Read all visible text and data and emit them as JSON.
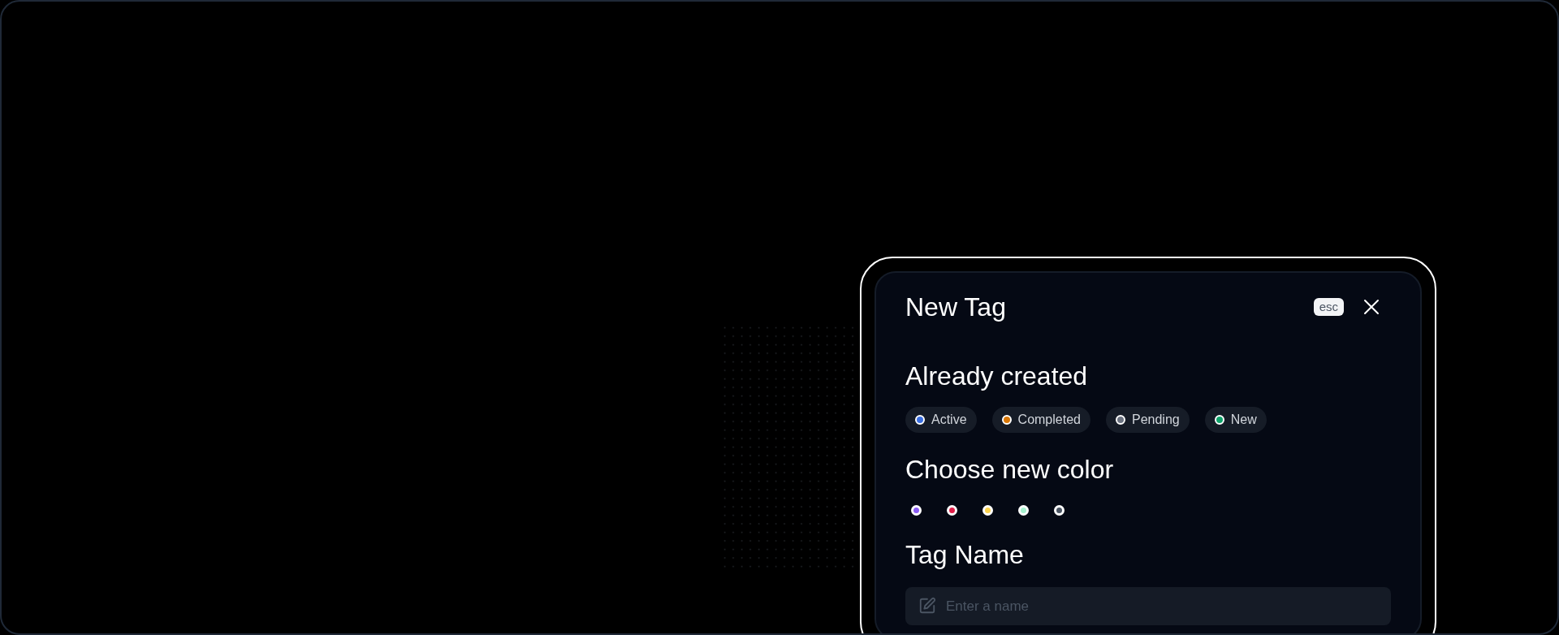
{
  "dialog": {
    "title": "New Tag",
    "esc_badge": "esc",
    "existing_section": {
      "heading": "Already created",
      "tags": [
        {
          "label": "Active",
          "color": "#3b6fe0"
        },
        {
          "label": "Completed",
          "color": "#d97706"
        },
        {
          "label": "Pending",
          "color": "#6b7280"
        },
        {
          "label": "New",
          "color": "#10a36b"
        }
      ]
    },
    "color_section": {
      "heading": "Choose new color",
      "swatches": [
        {
          "color": "#8b5cf6"
        },
        {
          "color": "#e11d48"
        },
        {
          "color": "#fcd34d"
        },
        {
          "color": "#a7f3d0"
        },
        {
          "color": "#4b5563"
        }
      ]
    },
    "name_section": {
      "heading": "Tag Name",
      "field": {
        "placeholder": "Enter a name"
      }
    }
  }
}
